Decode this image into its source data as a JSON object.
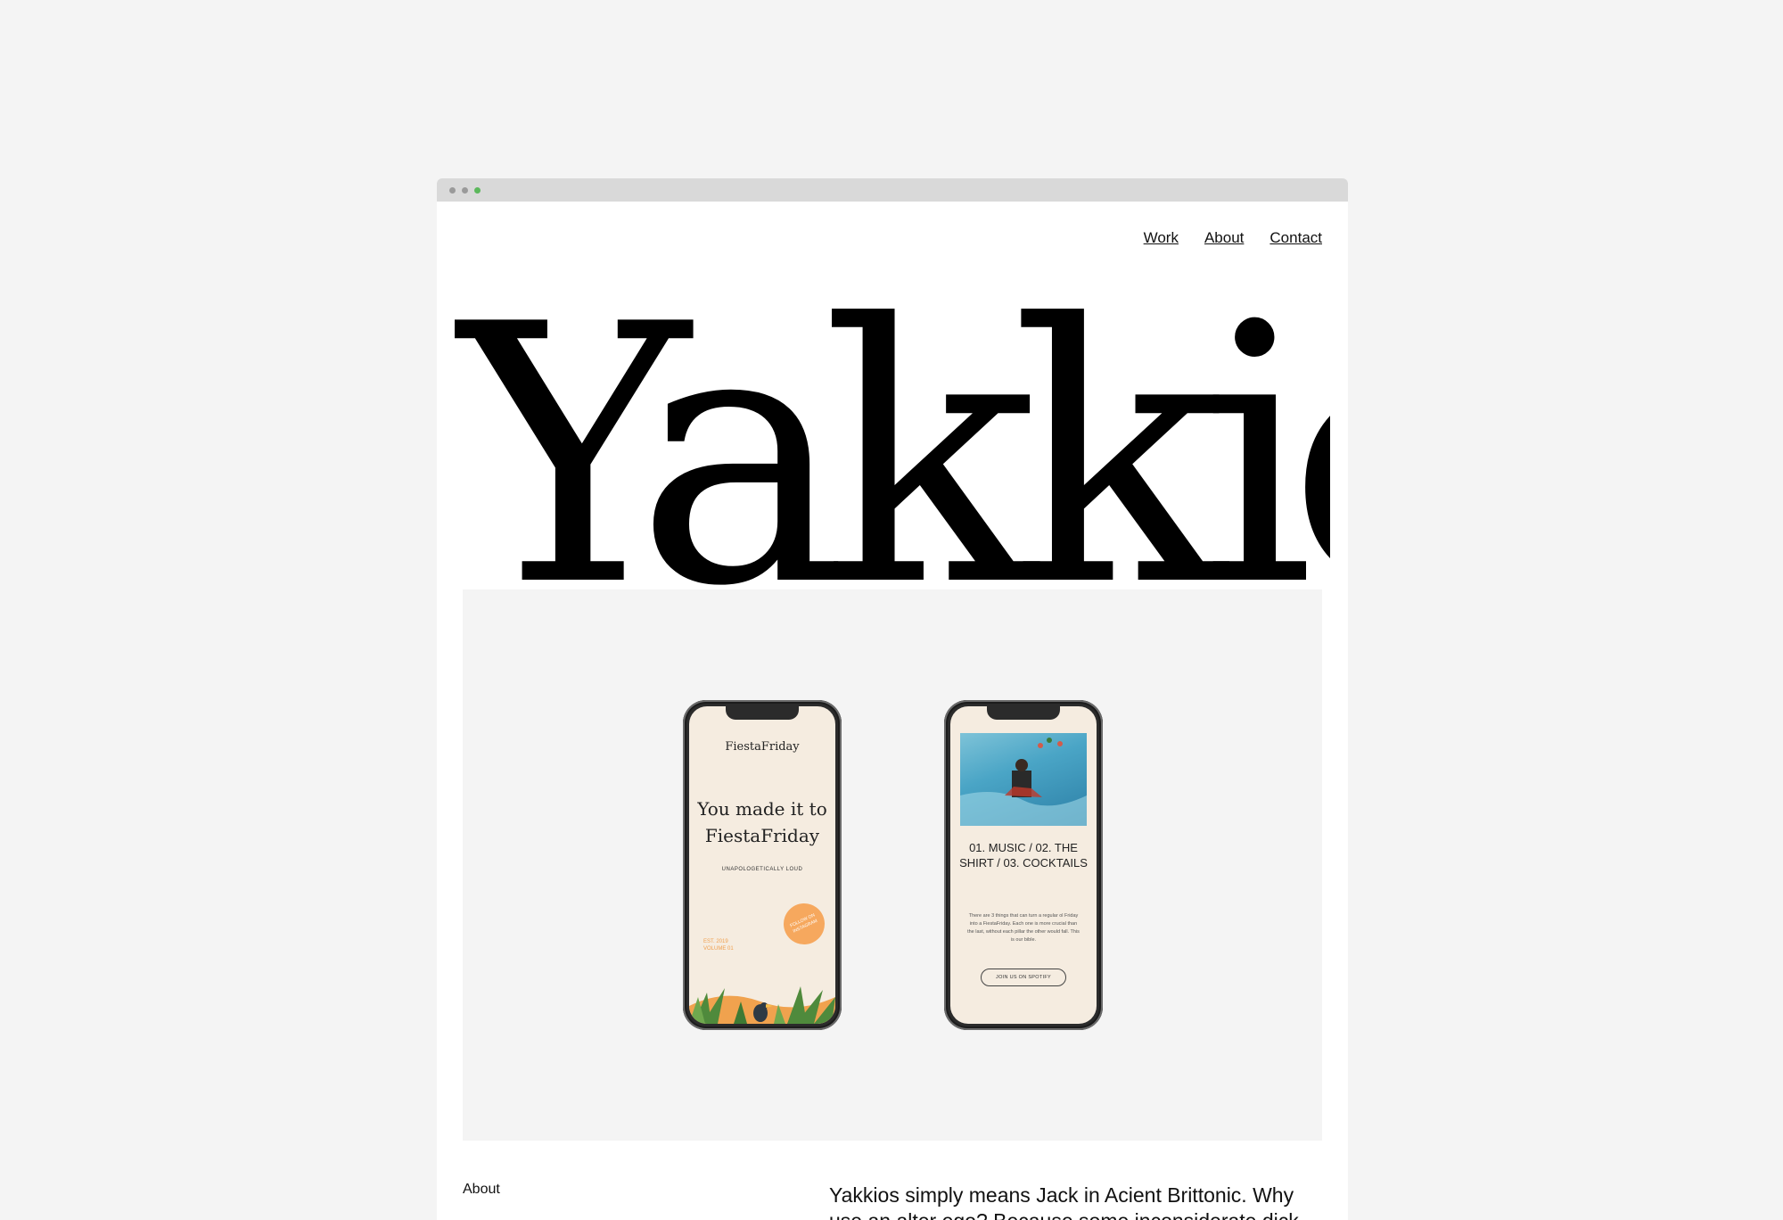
{
  "window": {
    "controls": [
      "close",
      "minimize",
      "maximize"
    ]
  },
  "nav": {
    "items": [
      {
        "label": "Work"
      },
      {
        "label": "About"
      },
      {
        "label": "Contact"
      }
    ]
  },
  "hero": {
    "logo_text": "Yakkios"
  },
  "phone_left": {
    "brand": "FiestaFriday",
    "headline_line1": "You made it to",
    "headline_line2": "FiestaFriday",
    "tagline": "UNAPOLOGETICALLY LOUD",
    "badge": "FOLLOW ON INSTAGRAM",
    "est_line1": "EST. 2019",
    "est_line2": "VOLUME 01"
  },
  "phone_right": {
    "title": "01. MUSIC / 02. THE SHIRT / 03. COCKTAILS",
    "body": "There are 3 things that can turn a regular ol Friday into a FiestaFriday. Each one is more crucial than the last, without each pillar the other would fall. This is our bible.",
    "button": "JOIN US ON SPOTIFY"
  },
  "about": {
    "label": "About",
    "text": "Yakkios simply means Jack in Acient Brittonic. Why use an alter ego? Because some inconsiderate dick"
  },
  "colors": {
    "page_bg": "#f4f4f4",
    "titlebar": "#d9d9d9",
    "accent_green": "#5cb85c",
    "phone_screen": "#f5ece0",
    "badge_orange": "#f6a85e"
  }
}
